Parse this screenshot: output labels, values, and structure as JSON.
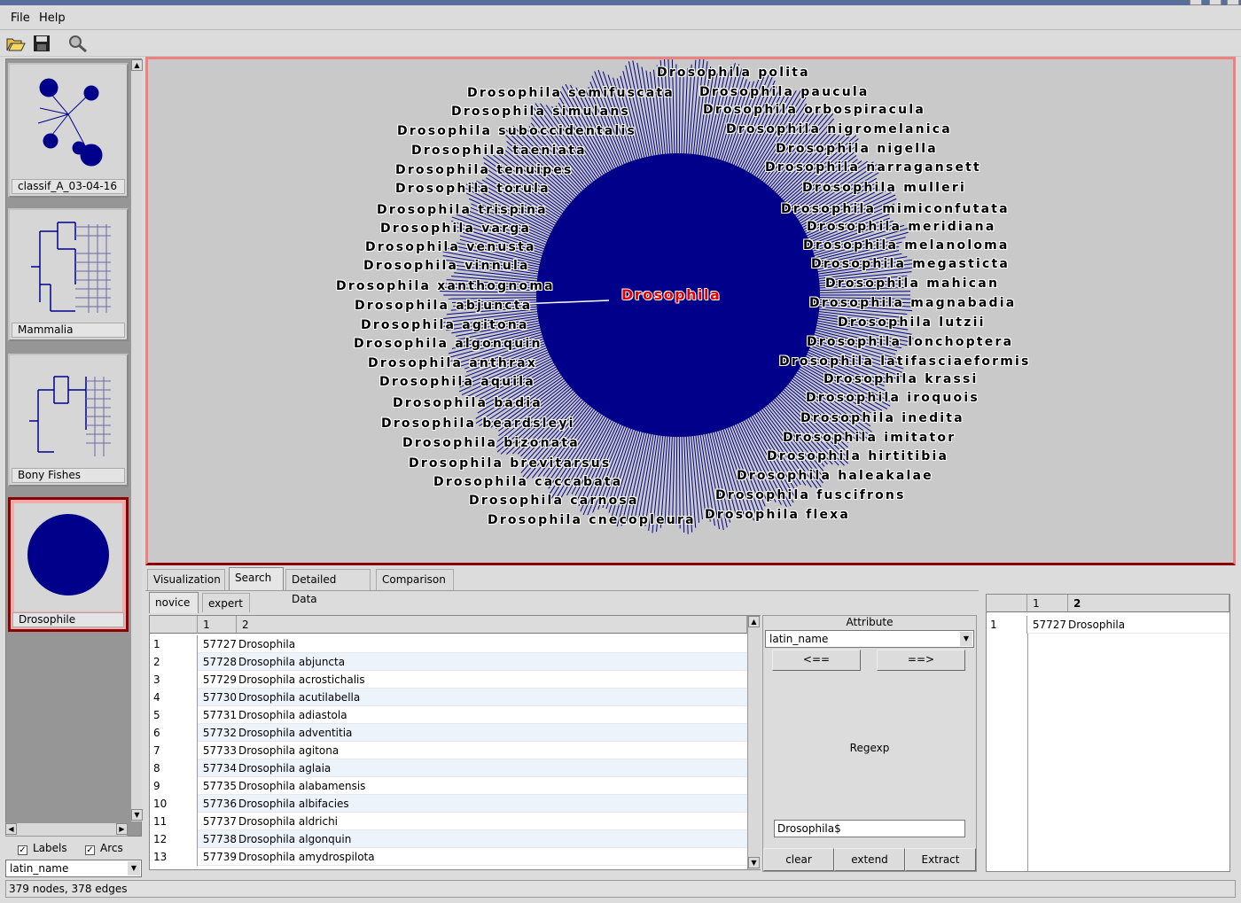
{
  "menu": {
    "file": "File",
    "help": "Help"
  },
  "toolbar": {
    "open": "open-folder-icon",
    "save": "save-disk-icon",
    "find": "magnifier-icon"
  },
  "thumbnails": [
    {
      "label": "classif_A_03-04-16"
    },
    {
      "label": "Mammalia"
    },
    {
      "label": "Bony Fishes"
    },
    {
      "label": "Drosophile"
    }
  ],
  "left_options": {
    "labels": "Labels",
    "arcs": "Arcs",
    "property": "latin_name"
  },
  "graph": {
    "center": "Drosophila",
    "labels_left": [
      "Drosophila semifuscata",
      "Drosophila simulans",
      "Drosophila suboccidentalis",
      "Drosophila taeniata",
      "Drosophila tenuipes",
      "Drosophila torula",
      "Drosophila trispina",
      "Drosophila varga",
      "Drosophila venusta",
      "Drosophila vinnula",
      "Drosophila xanthognoma",
      "Drosophila abjuncta",
      "Drosophila agitona",
      "Drosophila algonquin",
      "Drosophila anthrax",
      "Drosophila aquila",
      "Drosophila badia",
      "Drosophila beardsleyi",
      "Drosophila bizonata",
      "Drosophila brevitarsus",
      "Drosophila caccabata",
      "Drosophila carnosa",
      "Drosophila cnecopleura"
    ],
    "labels_right": [
      "Drosophila polita",
      "Drosophila paucula",
      "Drosophila orbospiracula",
      "Drosophila nigromelanica",
      "Drosophila nigella",
      "Drosophila narragansett",
      "Drosophila mulleri",
      "Drosophila mimiconfutata",
      "Drosophila meridiana",
      "Drosophila melanoloma",
      "Drosophila megasticta",
      "Drosophila mahican",
      "Drosophila magnabadia",
      "Drosophila lutzii",
      "Drosophila lonchoptera",
      "Drosophila latifasciaeformis",
      "Drosophila krassi",
      "Drosophila iroquois",
      "Drosophila inedita",
      "Drosophila imitator",
      "Drosophila hirtitibia",
      "Drosophila haleakalae",
      "Drosophila fuscifrons",
      "Drosophila flexa"
    ],
    "colors": {
      "tree": "#00008b",
      "background": "#c9c9c9",
      "center_label": "#e00000"
    }
  },
  "tabs": [
    "Visualization",
    "Search",
    "Detailed Data",
    "Comparison"
  ],
  "subtabs": [
    "novice",
    "expert"
  ],
  "table": {
    "headers": [
      "1",
      "2"
    ],
    "rows": [
      {
        "n": "1",
        "id": "57727",
        "name": "Drosophila"
      },
      {
        "n": "2",
        "id": "57728",
        "name": "Drosophila abjuncta"
      },
      {
        "n": "3",
        "id": "57729",
        "name": "Drosophila acrostichalis"
      },
      {
        "n": "4",
        "id": "57730",
        "name": "Drosophila acutilabella"
      },
      {
        "n": "5",
        "id": "57731",
        "name": "Drosophila adiastola"
      },
      {
        "n": "6",
        "id": "57732",
        "name": "Drosophila adventitia"
      },
      {
        "n": "7",
        "id": "57733",
        "name": "Drosophila agitona"
      },
      {
        "n": "8",
        "id": "57734",
        "name": "Drosophila aglaia"
      },
      {
        "n": "9",
        "id": "57735",
        "name": "Drosophila alabamensis"
      },
      {
        "n": "10",
        "id": "57736",
        "name": "Drosophila albifacies"
      },
      {
        "n": "11",
        "id": "57737",
        "name": "Drosophila aldrichi"
      },
      {
        "n": "12",
        "id": "57738",
        "name": "Drosophila algonquin"
      },
      {
        "n": "13",
        "id": "57739",
        "name": "Drosophila amydrospilota"
      }
    ]
  },
  "attribute": {
    "title": "Attribute",
    "selected": "latin_name",
    "left_btn": "<==",
    "right_btn": "==>",
    "regexp_label": "Regexp",
    "regexp_value": "Drosophila$",
    "clear": "clear",
    "extend": "extend",
    "extract": "Extract"
  },
  "result": {
    "headers": [
      "1",
      "2"
    ],
    "rows": [
      {
        "n": "1",
        "id": "57727",
        "name": "Drosophila"
      }
    ]
  },
  "status": "379 nodes, 378 edges"
}
